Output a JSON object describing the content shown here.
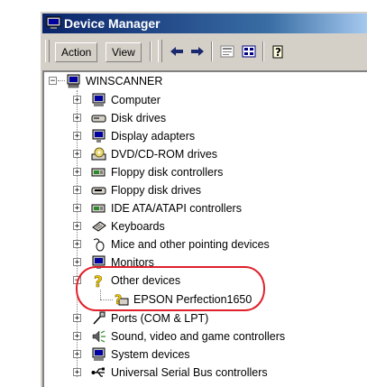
{
  "window": {
    "title": "Device Manager"
  },
  "toolbar": {
    "action_label": "Action",
    "view_label": "View"
  },
  "tree": {
    "root": "WINSCANNER",
    "items": [
      {
        "label": "Computer",
        "icon": "computer-icon"
      },
      {
        "label": "Disk drives",
        "icon": "disk-drive-icon"
      },
      {
        "label": "Display adapters",
        "icon": "monitor-icon"
      },
      {
        "label": "DVD/CD-ROM drives",
        "icon": "cdrom-icon"
      },
      {
        "label": "Floppy disk controllers",
        "icon": "controller-icon"
      },
      {
        "label": "Floppy disk drives",
        "icon": "floppy-drive-icon"
      },
      {
        "label": "IDE ATA/ATAPI controllers",
        "icon": "controller-icon"
      },
      {
        "label": "Keyboards",
        "icon": "keyboard-icon"
      },
      {
        "label": "Mice and other pointing devices",
        "icon": "mouse-icon"
      },
      {
        "label": "Monitors",
        "icon": "monitor-icon"
      },
      {
        "label": "Other devices",
        "icon": "question-mark-icon",
        "expanded": true
      },
      {
        "label": "EPSON Perfection1650",
        "icon": "warning-device-icon",
        "child": true
      },
      {
        "label": "Ports (COM & LPT)",
        "icon": "port-icon"
      },
      {
        "label": "Sound, video and game controllers",
        "icon": "speaker-icon"
      },
      {
        "label": "System devices",
        "icon": "computer-icon"
      },
      {
        "label": "Universal Serial Bus controllers",
        "icon": "usb-icon"
      }
    ]
  },
  "colors": {
    "titlebar": "#0a246a",
    "highlight": "#e0202a"
  }
}
